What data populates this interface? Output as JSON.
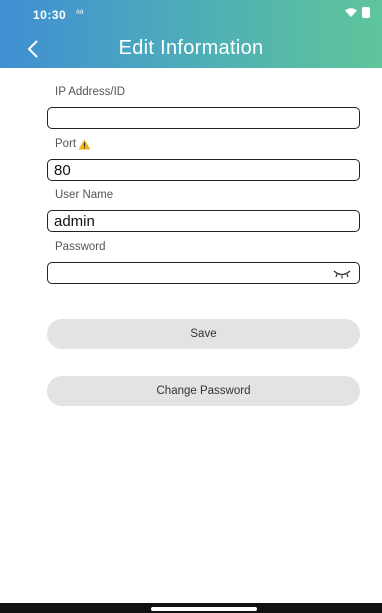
{
  "status_bar": {
    "time": "10:30",
    "signal": "ᵃᵃ"
  },
  "header": {
    "title": "Edit Information"
  },
  "form": {
    "ip": {
      "label": "IP Address/ID",
      "value": ""
    },
    "port": {
      "label": "Port",
      "value": "80"
    },
    "username": {
      "label": "User Name",
      "value": "admin"
    },
    "password": {
      "label": "Password",
      "value": ""
    }
  },
  "buttons": {
    "save": "Save",
    "change_password": "Change Password"
  },
  "colors": {
    "header_start": "#3f8fd3",
    "header_end": "#5fc59a",
    "warning": "#f2b51a",
    "pill": "#e3e3e5"
  }
}
